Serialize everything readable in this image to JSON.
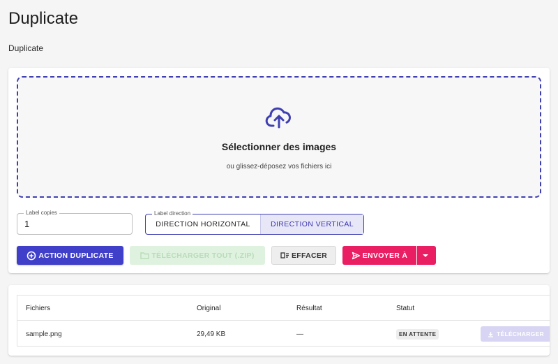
{
  "page": {
    "title": "Duplicate",
    "subtitle": "Duplicate"
  },
  "upload": {
    "icon": "cloud-upload-icon",
    "title": "Sélectionner des images",
    "hint": "ou glissez-déposez vos fichiers ici"
  },
  "controls": {
    "copies": {
      "label": "Label copies",
      "value": "1"
    },
    "direction": {
      "label": "Label direction",
      "options": [
        "DIRECTION HORIZONTAL",
        "DIRECTION VERTICAL"
      ],
      "selected": "DIRECTION VERTICAL"
    }
  },
  "actions": {
    "duplicate": "ACTION DUPLICATE",
    "download_all": "TÉLÉCHARGER TOUT (.ZIP)",
    "clear": "EFFACER",
    "send_to": "ENVOYER À"
  },
  "table": {
    "headers": [
      "Fichiers",
      "Original",
      "Résultat",
      "Statut"
    ],
    "rows": [
      {
        "file": "sample.png",
        "original": "29,49 KB",
        "result": "—",
        "status": "EN ATTENTE",
        "download": "TÉLÉCHARGER"
      }
    ]
  },
  "colors": {
    "primary": "#3f3fc9",
    "accent": "#e91e63",
    "success_disabled": "#dff2df"
  }
}
